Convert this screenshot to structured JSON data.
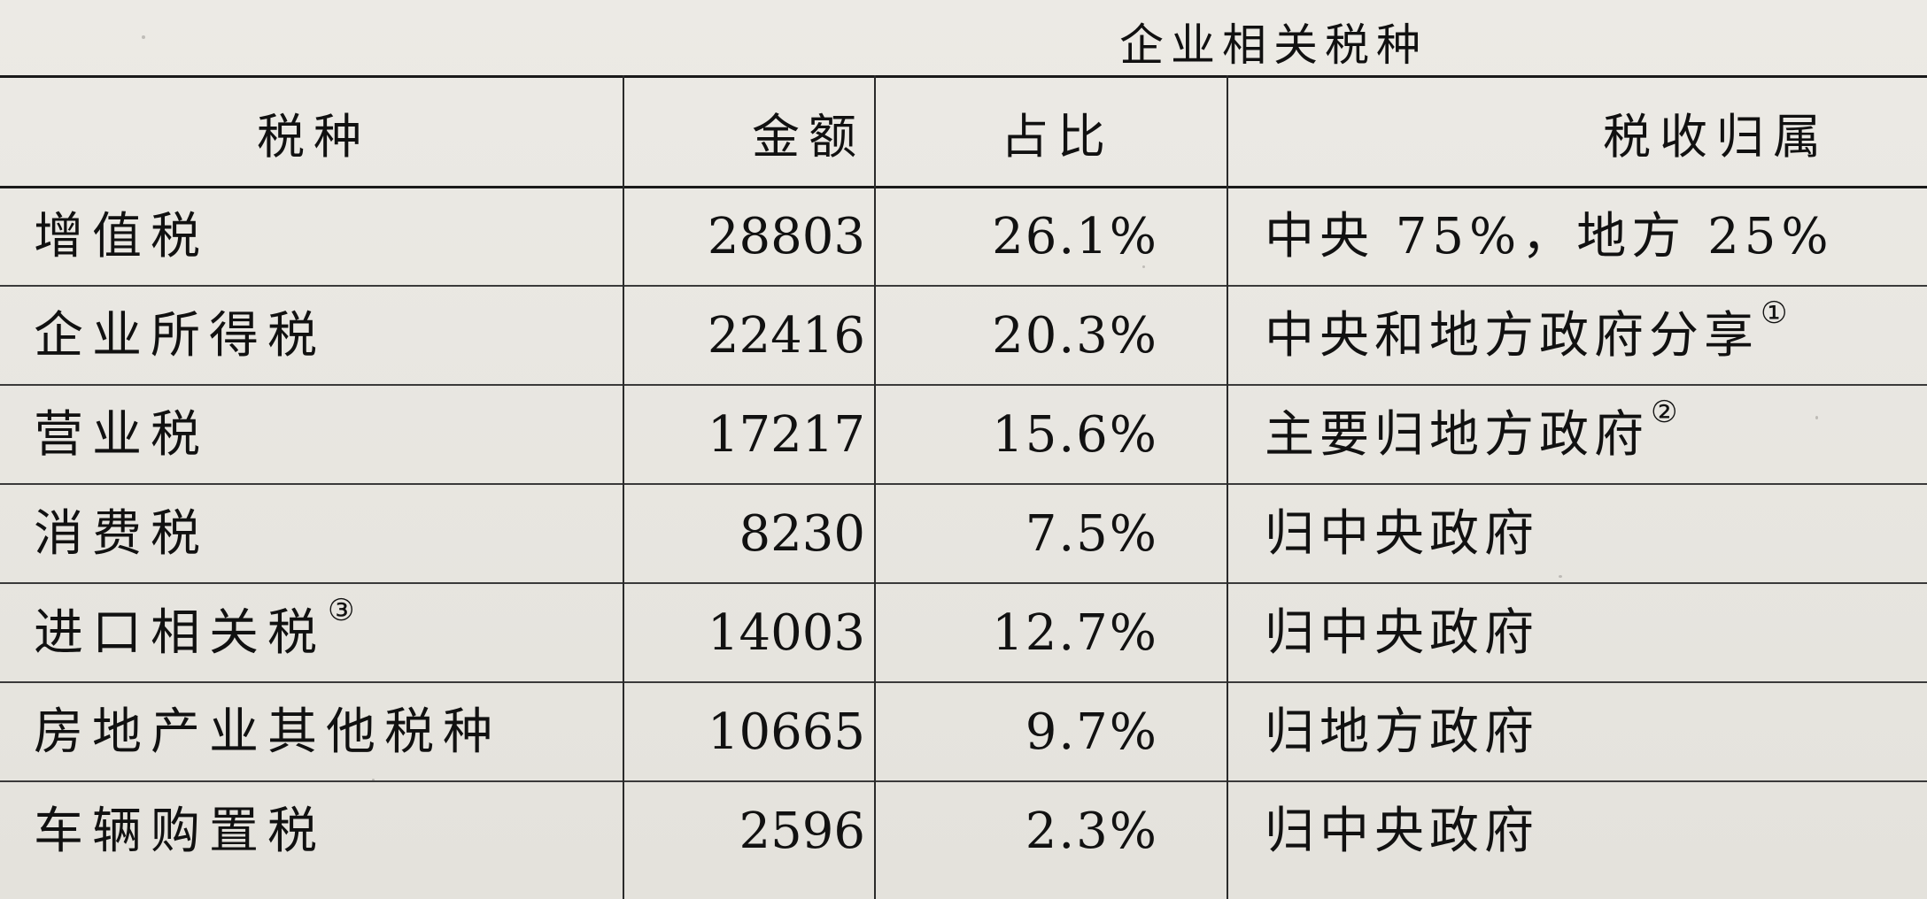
{
  "caption": "企业相关税种",
  "headers": {
    "name": "税种",
    "amount": "金额",
    "share": "占比",
    "ownership": "税收归属"
  },
  "rows": [
    {
      "name": "增值税",
      "name_note": "",
      "amount": "28803",
      "share": "26.1%",
      "ownership": "中央 75%，地方 25%",
      "ownership_note": ""
    },
    {
      "name": "企业所得税",
      "name_note": "",
      "amount": "22416",
      "share": "20.3%",
      "ownership": "中央和地方政府分享",
      "ownership_note": "①"
    },
    {
      "name": "营业税",
      "name_note": "",
      "amount": "17217",
      "share": "15.6%",
      "ownership": "主要归地方政府",
      "ownership_note": "②"
    },
    {
      "name": "消费税",
      "name_note": "",
      "amount": "8230",
      "share": "7.5%",
      "ownership": "归中央政府",
      "ownership_note": ""
    },
    {
      "name": "进口相关税",
      "name_note": "③",
      "amount": "14003",
      "share": "12.7%",
      "ownership": "归中央政府",
      "ownership_note": ""
    },
    {
      "name": "房地产业其他税种",
      "name_note": "",
      "amount": "10665",
      "share": "9.7%",
      "ownership": "归地方政府",
      "ownership_note": ""
    },
    {
      "name": "车辆购置税",
      "name_note": "",
      "amount": "2596",
      "share": "2.3%",
      "ownership": "归中央政府",
      "ownership_note": ""
    }
  ]
}
